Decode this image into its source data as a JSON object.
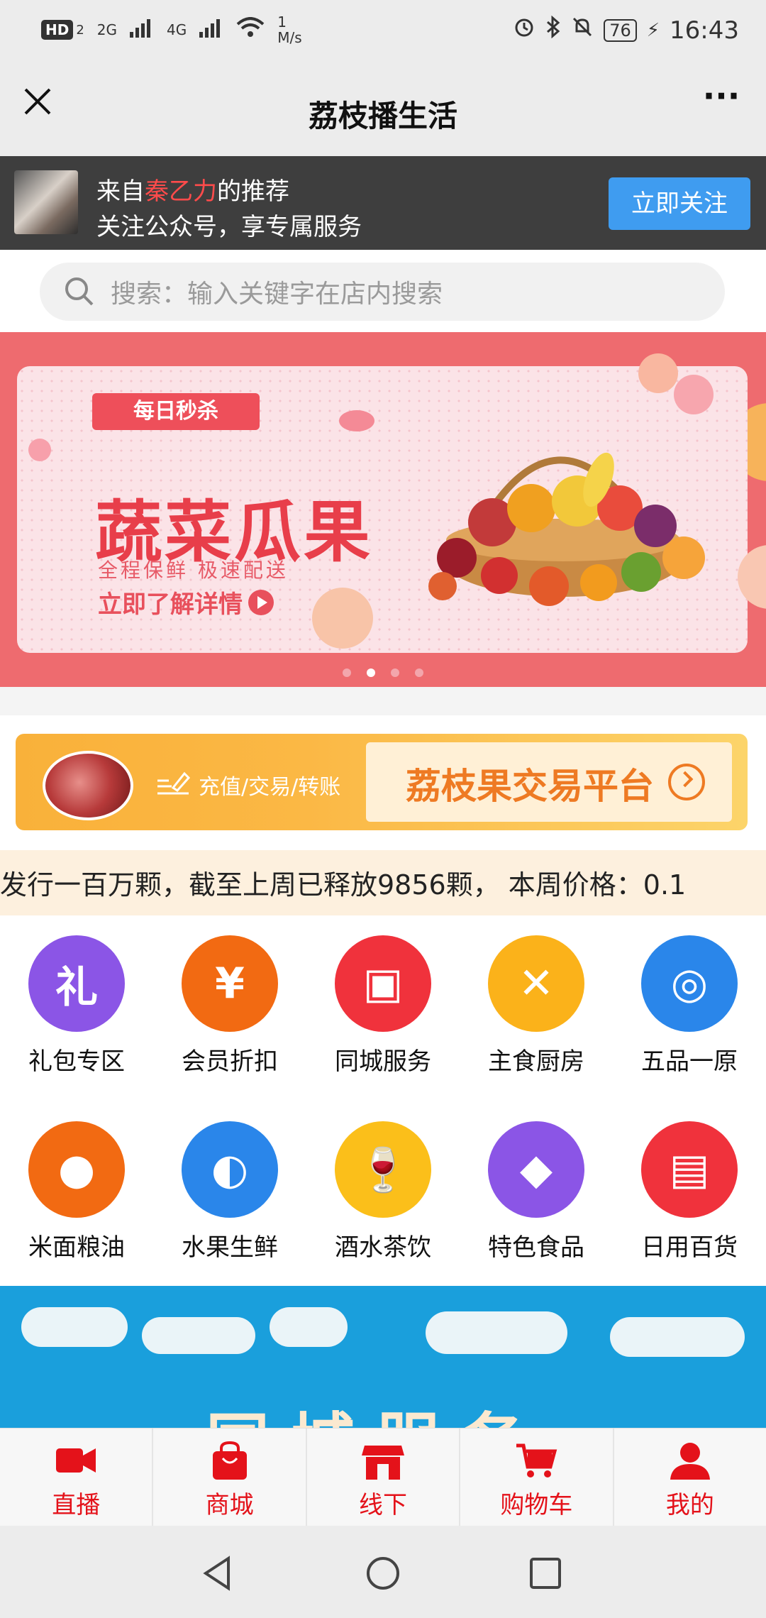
{
  "status_bar": {
    "hd": "HD",
    "hd_sub": "2",
    "net1": "2G",
    "net2": "4G",
    "speed": "1",
    "speed_unit": "M/s",
    "battery": "76",
    "time": "16:43"
  },
  "titlebar": {
    "title": "荔枝播生活",
    "more": "···"
  },
  "follow_banner": {
    "prefix": "来自",
    "referrer": "秦乙力",
    "suffix": "的推荐",
    "line2": "关注公众号，享专属服务",
    "button": "立即关注"
  },
  "search": {
    "placeholder": "搜索：输入关键字在店内搜索"
  },
  "hero": {
    "tag": "每日秒杀",
    "title": "蔬菜瓜果",
    "subtitle": "全程保鲜  极速配送",
    "cta": "立即了解详情"
  },
  "trade": {
    "ops": "充值/交易/转账",
    "title": "荔枝果交易平台"
  },
  "marquee": {
    "text": "发行一百万颗，截至上周已释放9856颗， 本周价格：0.1"
  },
  "categories": [
    {
      "label": "礼包专区",
      "glyph": "礼",
      "icon": "gift-icon",
      "color": "#8b55e6"
    },
    {
      "label": "会员折扣",
      "glyph": "¥",
      "icon": "coupon-icon",
      "color": "#f26a12"
    },
    {
      "label": "同城服务",
      "glyph": "▣",
      "icon": "package-icon",
      "color": "#f0323c"
    },
    {
      "label": "主食厨房",
      "glyph": "✕",
      "icon": "utensils-icon",
      "color": "#fbb21a"
    },
    {
      "label": "五品一原",
      "glyph": "◎",
      "icon": "badge-icon",
      "color": "#2a86ea"
    },
    {
      "label": "米面粮油",
      "glyph": "●",
      "icon": "grain-icon",
      "color": "#f26a12"
    },
    {
      "label": "水果生鲜",
      "glyph": "◐",
      "icon": "orange-icon",
      "color": "#2a86ea"
    },
    {
      "label": "酒水茶饮",
      "glyph": "🍷",
      "icon": "wine-icon",
      "color": "#fbbf1a"
    },
    {
      "label": "特色食品",
      "glyph": "◆",
      "icon": "diamond-icon",
      "color": "#8b55e6"
    },
    {
      "label": "日用百货",
      "glyph": "▤",
      "icon": "tissue-icon",
      "color": "#f0323c"
    }
  ],
  "city_section": {
    "title": "同城服务"
  },
  "bottom_nav": [
    {
      "label": "直播",
      "icon": "video-icon"
    },
    {
      "label": "商城",
      "icon": "shopping-bag-icon"
    },
    {
      "label": "线下",
      "icon": "store-icon"
    },
    {
      "label": "购物车",
      "icon": "cart-icon"
    },
    {
      "label": "我的",
      "icon": "user-icon"
    }
  ],
  "colors": {
    "accent_red": "#e4121a",
    "follow_button": "#3f9cf0",
    "hero_bg": "#ee6b6f"
  }
}
